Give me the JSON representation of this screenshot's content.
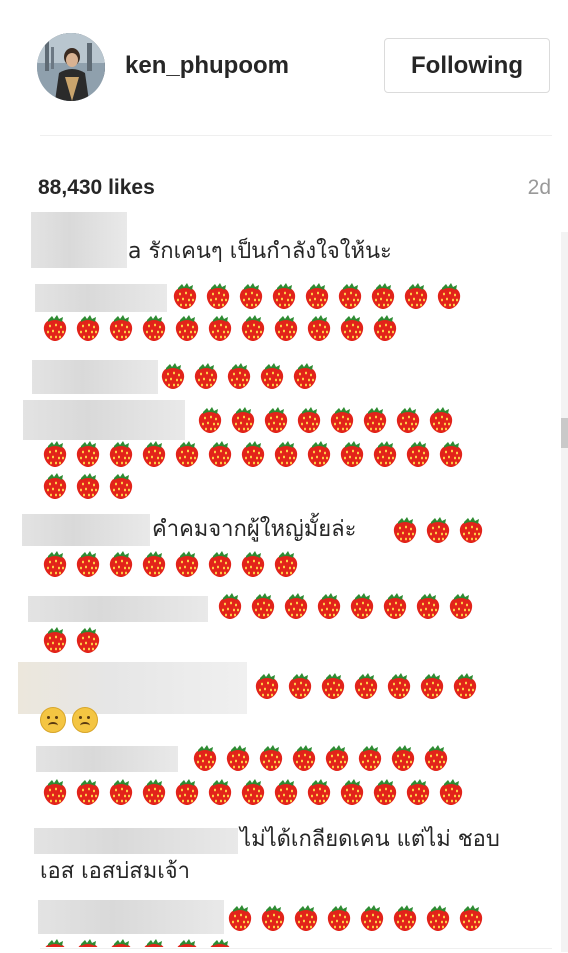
{
  "post": {
    "username": "ken_phupoom",
    "follow_label": "Following",
    "likes": "88,430 likes",
    "age": "2d"
  },
  "comments": [
    {
      "text": "a รักเคนๆ เป็นกำลังใจให้นะ",
      "emojis": 0
    },
    {
      "text": "",
      "emojis": 20
    },
    {
      "text": "",
      "emojis": 5
    },
    {
      "text": "",
      "emojis": 24
    },
    {
      "text": "คำคมจากผู้ใหญ่มั้ยล่ะ",
      "emojis": 11
    },
    {
      "text": "",
      "emojis": 10
    },
    {
      "text": "",
      "emojis": 7,
      "extra": "frown-face x2"
    },
    {
      "text": "",
      "emojis": 21
    },
    {
      "text": "ไม่ได้เกลียดเคน แต่ไม่ ชอบเอส เอสบ่สมเจ้า",
      "emojis": 0
    },
    {
      "text": "",
      "emojis": 14
    }
  ],
  "icons": {
    "strawberry": "strawberry-icon",
    "frown": "frowning-face-icon"
  },
  "colors": {
    "text": "#262626",
    "muted": "#999999",
    "border": "#dbdbdb",
    "strawberry": "#e2231a"
  }
}
